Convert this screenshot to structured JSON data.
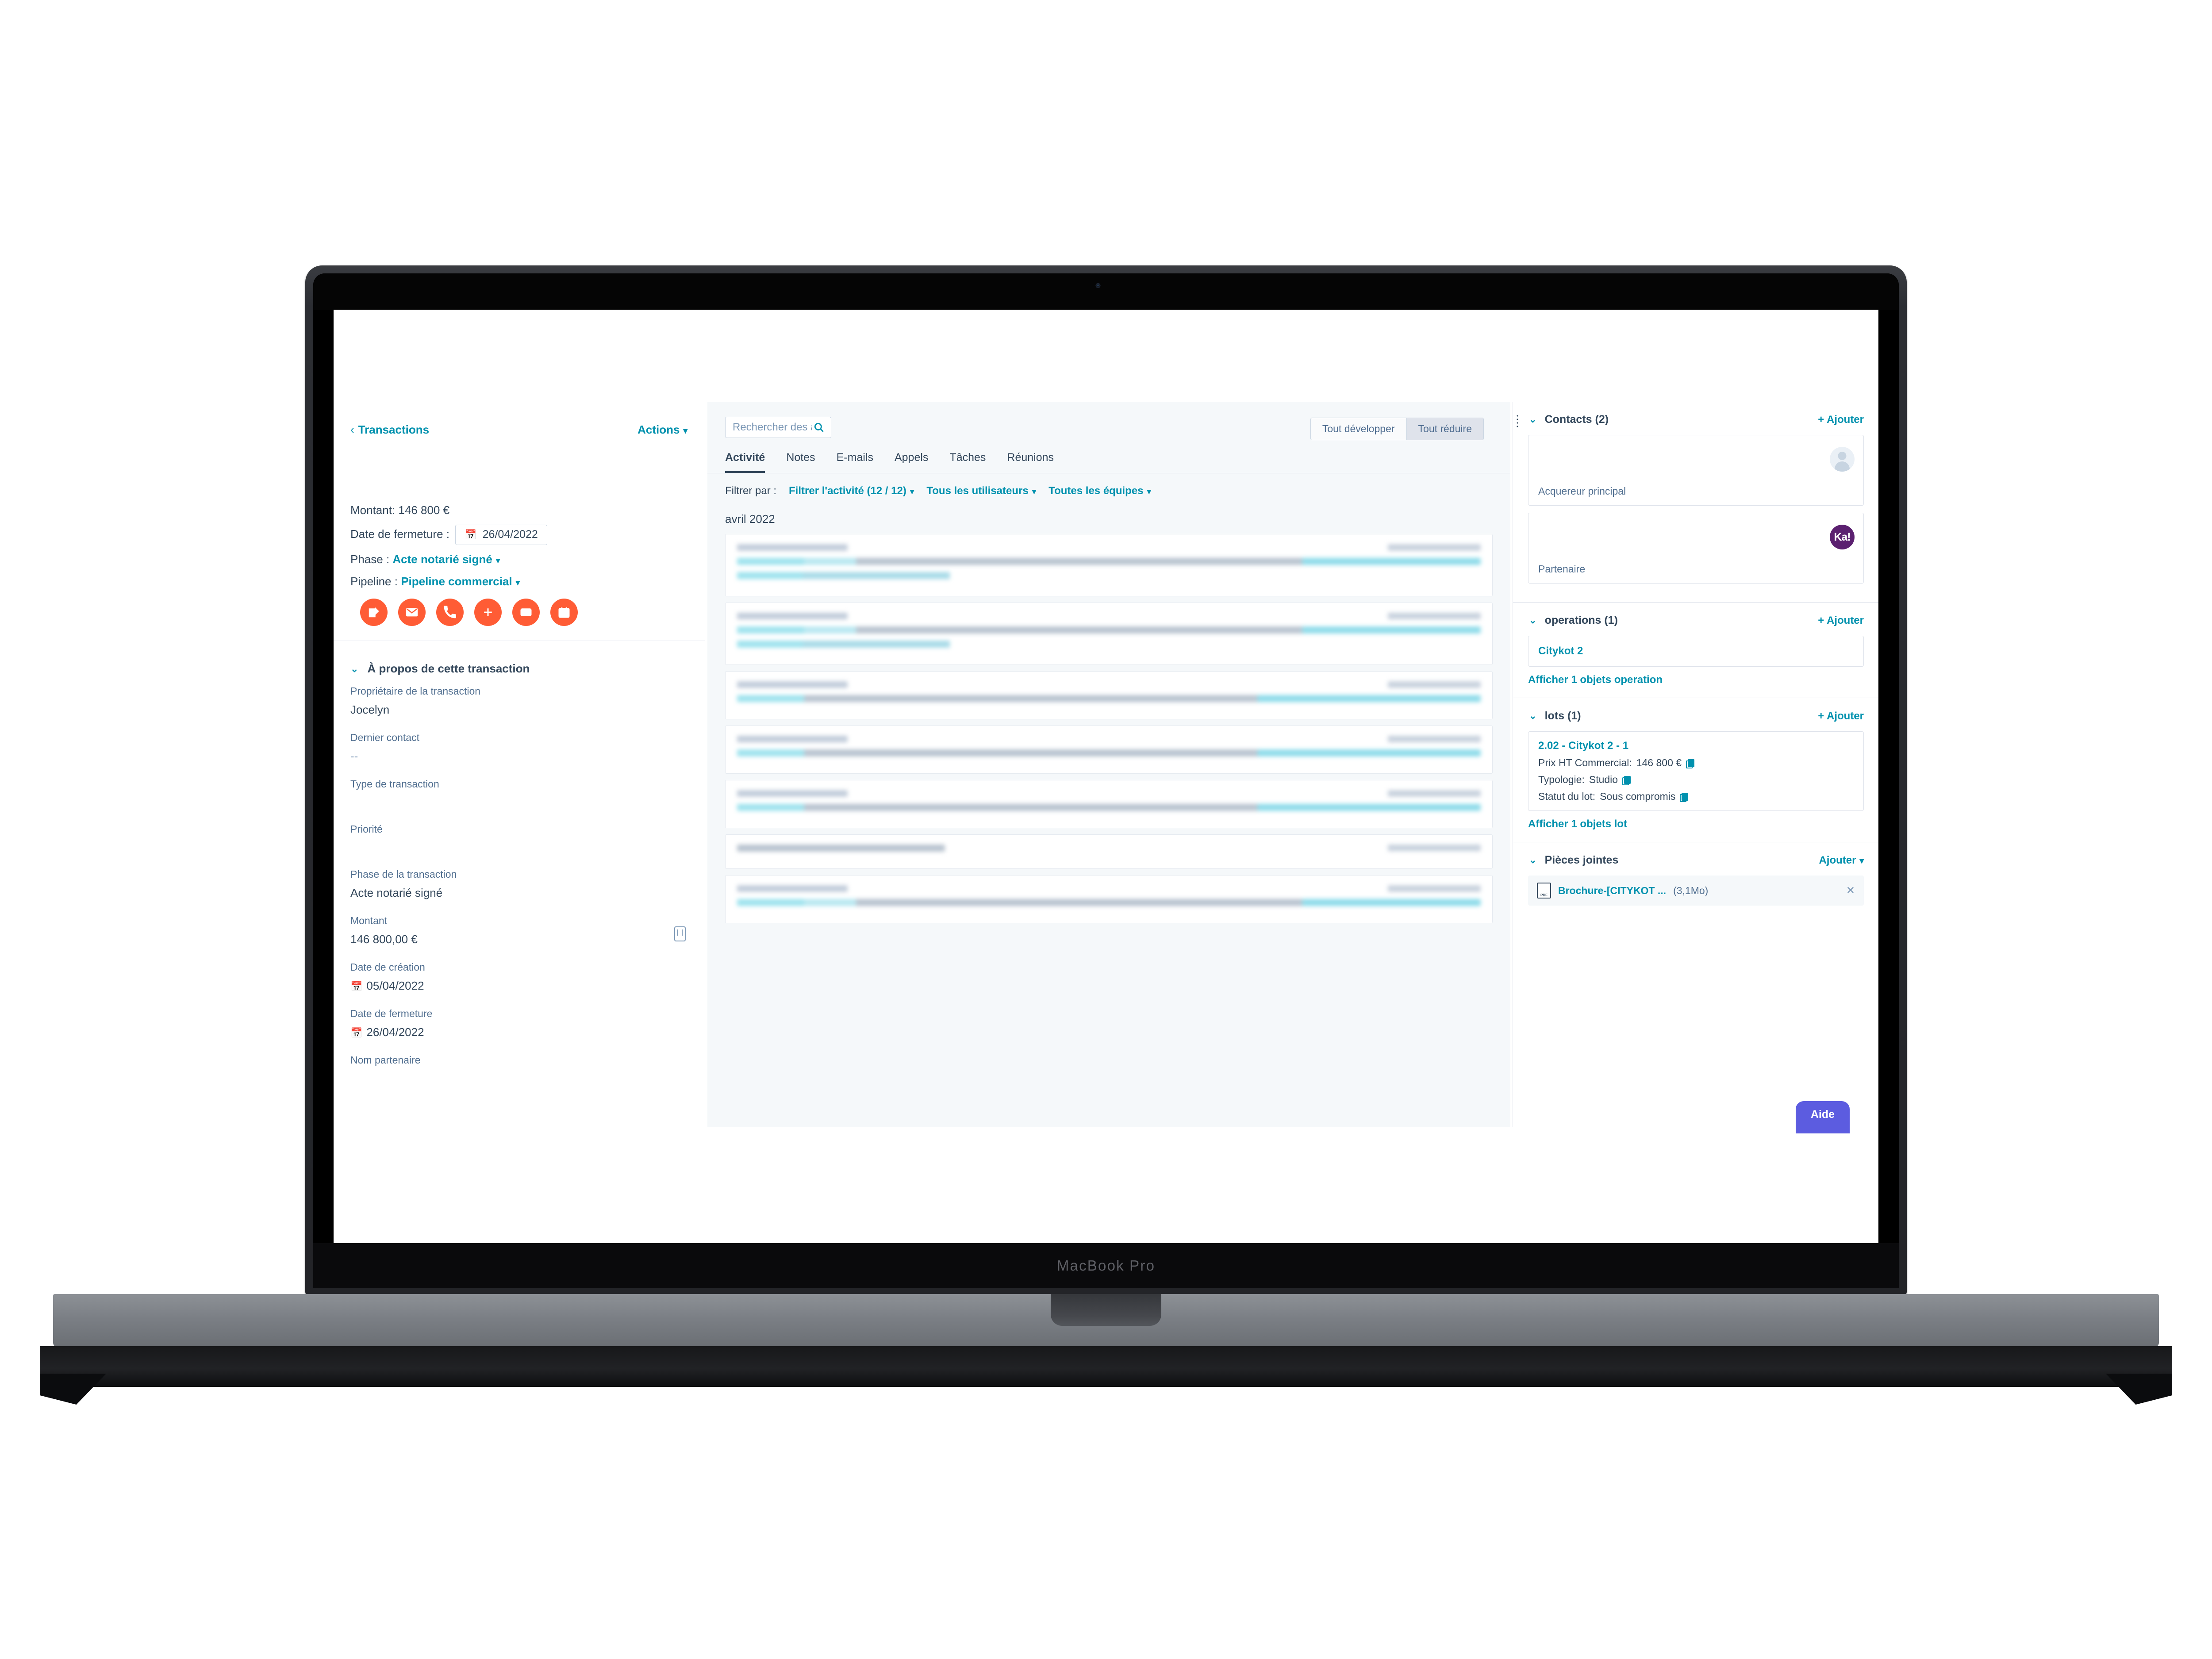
{
  "device": {
    "label": "MacBook Pro"
  },
  "left_panel": {
    "back_link": "Transactions",
    "back_chevron": "‹",
    "actions_label": "Actions",
    "summary": {
      "amount_label": "Montant:",
      "amount_value": "146 800 €",
      "close_date_label": "Date de fermeture :",
      "close_date_value": "26/04/2022",
      "phase_label": "Phase :",
      "phase_value": "Acte notarié signé",
      "pipeline_label": "Pipeline :",
      "pipeline_value": "Pipeline commercial"
    },
    "action_icons": [
      {
        "name": "note-icon",
        "title": "Note"
      },
      {
        "name": "email-icon",
        "title": "E-mail"
      },
      {
        "name": "call-icon",
        "title": "Appel"
      },
      {
        "name": "plus-icon",
        "title": "Ajouter"
      },
      {
        "name": "task-icon",
        "title": "Tâche"
      },
      {
        "name": "meeting-icon",
        "title": "Réunion"
      }
    ],
    "about": {
      "title": "À propos de cette transaction",
      "fields": [
        {
          "label": "Propriétaire de la transaction",
          "value": "Jocelyn"
        },
        {
          "label": "Dernier contact",
          "value": "--"
        },
        {
          "label": "Type de transaction",
          "value": ""
        },
        {
          "label": "Priorité",
          "value": ""
        },
        {
          "label": "Phase de la transaction",
          "value": "Acte notarié signé"
        },
        {
          "label": "Montant",
          "value": "146 800,00 €"
        },
        {
          "label": "Date de création",
          "value": "05/04/2022"
        },
        {
          "label": "Date de fermeture",
          "value": "26/04/2022"
        },
        {
          "label": "Nom partenaire",
          "value": ""
        }
      ]
    }
  },
  "center_panel": {
    "search": {
      "placeholder": "Rechercher des activités",
      "value": ""
    },
    "expand_buttons": {
      "expand_all": "Tout développer",
      "collapse_all": "Tout réduire"
    },
    "tabs": [
      {
        "label": "Activité",
        "active": true
      },
      {
        "label": "Notes",
        "active": false
      },
      {
        "label": "E-mails",
        "active": false
      },
      {
        "label": "Appels",
        "active": false
      },
      {
        "label": "Tâches",
        "active": false
      },
      {
        "label": "Réunions",
        "active": false
      }
    ],
    "filter": {
      "prefix": "Filtrer par :",
      "activity_filter": "Filtrer l'activité (12 / 12)",
      "users_filter": "Tous les utilisateurs",
      "teams_filter": "Toutes les équipes"
    },
    "month_group": "avril 2022",
    "activity_cards": 7
  },
  "right_panel": {
    "contacts": {
      "title": "Contacts (2)",
      "add_label": "+ Ajouter",
      "items": [
        {
          "role": "Acquereur principal",
          "avatar": "generic"
        },
        {
          "role": "Partenaire",
          "avatar": "Ka!"
        }
      ]
    },
    "operations": {
      "title": "operations (1)",
      "add_label": "+ Ajouter",
      "items": [
        {
          "name": "Citykot 2"
        }
      ],
      "show_link": "Afficher 1 objets operation"
    },
    "lots": {
      "title": "lots (1)",
      "add_label": "+ Ajouter",
      "items": [
        {
          "name": "2.02 - Citykot 2 - 1",
          "rows": [
            {
              "label": "Prix HT Commercial:",
              "value": "146 800 €"
            },
            {
              "label": "Typologie:",
              "value": "Studio"
            },
            {
              "label": "Statut du lot:",
              "value": "Sous compromis"
            }
          ]
        }
      ],
      "show_link": "Afficher 1 objets lot"
    },
    "attachments": {
      "title": "Pièces jointes",
      "add_label": "Ajouter",
      "items": [
        {
          "name": "Brochure-[CITYKOT ...",
          "size": "(3,1Mo)"
        }
      ]
    }
  },
  "help_button": {
    "label": "Aide"
  },
  "colors": {
    "accent_teal": "#0091ae",
    "action_orange": "#ff5c35",
    "text_dark": "#33475b",
    "text_muted": "#516f90",
    "panel_bg": "#f5f8fa",
    "border": "#dfe3eb",
    "help_purple": "#5c5ce0",
    "avatar_purple": "#5b2070"
  }
}
